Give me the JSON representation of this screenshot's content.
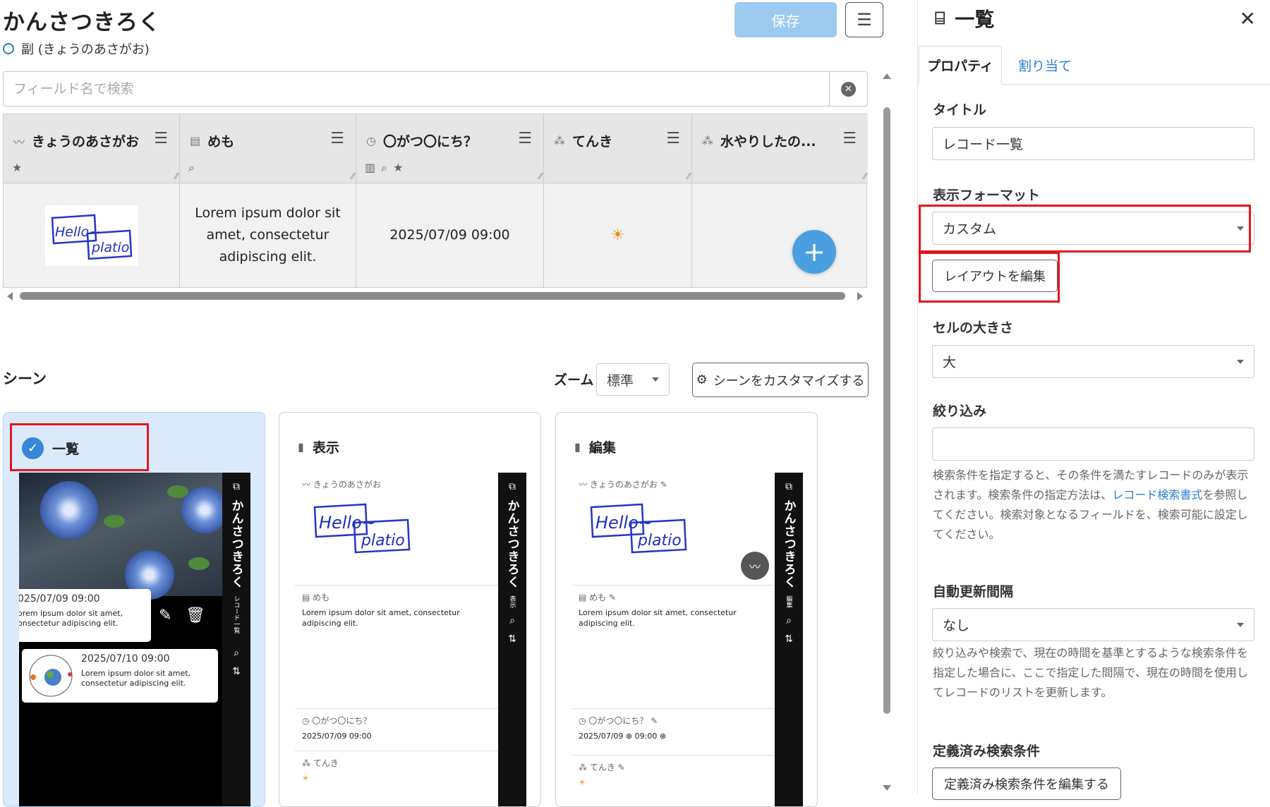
{
  "header": {
    "app_title": "かんさつきろく",
    "subtitle": "副 (きょうのあさがお)",
    "save_label": "保存"
  },
  "search": {
    "placeholder": "フィールド名で検索"
  },
  "grid": {
    "columns": [
      {
        "name": "きょうのあさがお",
        "icon": "handwriting-icon"
      },
      {
        "name": "めも",
        "icon": "memo-icon"
      },
      {
        "name": "〇がつ〇にち？",
        "icon": "datetime-icon"
      },
      {
        "name": "てんき",
        "icon": "weather-icon"
      },
      {
        "name": "水やりしたの...",
        "icon": "checkbox-field-icon"
      }
    ],
    "row": {
      "memo": "Lorem ipsum dolor sit amet, consectetur adipiscing elit.",
      "date": "2025/07/09 09:00",
      "weather": "☀"
    }
  },
  "scenes": {
    "title": "シーン",
    "zoom_label": "ズーム",
    "zoom_value": "標準",
    "customize_label": "シーンをカスタマイズする",
    "cards": [
      {
        "label": "一覧",
        "selected": true
      },
      {
        "label": "表示",
        "selected": false
      },
      {
        "label": "編集",
        "selected": false
      }
    ],
    "preview": {
      "app_title": "かんさつきろく",
      "list_subtitle": "レコード一覧",
      "view_subtitle": "表示",
      "edit_subtitle": "編集",
      "field1": "きょうのあさがお",
      "field2": "めも",
      "field3": "〇がつ〇にち？",
      "field4": "てんき",
      "memo": "Lorem ipsum dolor sit amet, consectetur adipiscing elit.",
      "memo_crop": "orem ipsum dolor sit amet, onsectetur adipiscing elit.",
      "date1": "2025/07/09 09:00",
      "date1_crop": "025/07/09 09:00",
      "date2": "2025/07/10 09:00",
      "edit_date": "2025/07/09",
      "edit_time": "09:00",
      "handwriting": "Hello~ platio"
    }
  },
  "properties": {
    "title": "一覧",
    "tabs": [
      "プロパティ",
      "割り当て"
    ],
    "title_label": "タイトル",
    "title_value": "レコード一覧",
    "format_label": "表示フォーマット",
    "format_value": "カスタム",
    "edit_layout_label": "レイアウトを編集",
    "cell_size_label": "セルの大きさ",
    "cell_size_value": "大",
    "filter_label": "絞り込み",
    "filter_value": "",
    "filter_help_before": "検索条件を指定すると、その条件を満たすレコードのみが表示されます。検索条件の指定方法は、",
    "filter_help_link": "レコード検索書式",
    "filter_help_after": "を参照してください。検索対象となるフィールドを、検索可能に設定してください。",
    "refresh_label": "自動更新間隔",
    "refresh_value": "なし",
    "refresh_help": "絞り込みや検索で、現在の時間を基準とするような検索条件を指定した場合に、ここで指定した間隔で、現在の時間を使用してレコードのリストを更新します。",
    "predef_label": "定義済み検索条件",
    "predef_button": "定義済み検索条件を編集する"
  },
  "colors": {
    "accent": "#4a9fe0",
    "highlight": "#e3161c",
    "selected_card": "#dbeafa"
  }
}
